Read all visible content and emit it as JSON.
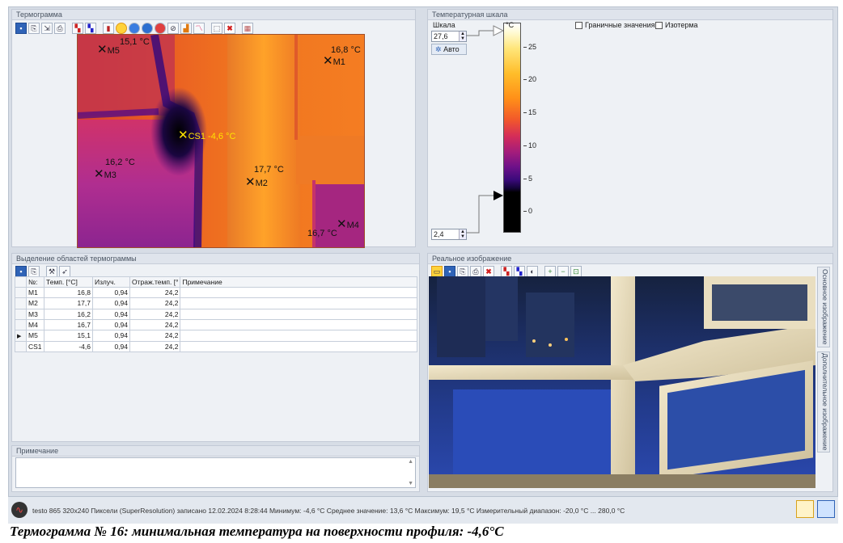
{
  "thermogram": {
    "title": "Термограмма",
    "markers": [
      {
        "label": "M5",
        "temp": "15,1 °C"
      },
      {
        "label": "M1",
        "temp": "16,8 °C"
      },
      {
        "label": "CS1",
        "temp": "-4,6 °C",
        "text": "CS1 -4,6 °C"
      },
      {
        "label": "M3",
        "temp": "16,2 °C"
      },
      {
        "label": "M2",
        "temp": "17,7 °C"
      },
      {
        "label": "M4",
        "temp": "16,7 °C"
      }
    ]
  },
  "scale": {
    "title": "Температурная шкала",
    "scale_label": "Шкала",
    "max_value": "27,6",
    "min_value": "2,4",
    "auto_label": "Авто",
    "unit": "°C",
    "ticks": [
      "25",
      "20",
      "15",
      "10",
      "5",
      "0"
    ],
    "boundary_label": "Граничные значения",
    "isotherm_label": "Изотерма"
  },
  "regions": {
    "title": "Выделение областей термограммы",
    "columns": [
      "№:",
      "Темп. [°C]",
      "Излуч.",
      "Отраж.темп. [°",
      "Примечание"
    ],
    "rows": [
      [
        "M1",
        "16,8",
        "0,94",
        "24,2",
        ""
      ],
      [
        "M2",
        "17,7",
        "0,94",
        "24,2",
        ""
      ],
      [
        "M3",
        "16,2",
        "0,94",
        "24,2",
        ""
      ],
      [
        "M4",
        "16,7",
        "0,94",
        "24,2",
        ""
      ],
      [
        "M5",
        "15,1",
        "0,94",
        "24,2",
        ""
      ],
      [
        "CS1",
        "-4,6",
        "0,94",
        "24,2",
        ""
      ]
    ],
    "selected_row": 4
  },
  "note": {
    "title": "Примечание"
  },
  "real_image": {
    "title": "Реальное изображение",
    "tab_main": "Основное изображение",
    "tab_extra": "Дополнительное изображение"
  },
  "status": {
    "text": "testo 865 320x240 Пиксели (SuperResolution) записано 12.02.2024 8:28:44  Минимум: -4,6 °C  Среднее значение: 13,6 °C  Максимум: 19,5 °C  Измерительный диапазон: -20,0 °C ... 280,0 °C"
  },
  "caption": "Термограмма № 16: минимальная температура на поверхности профиля: -4,6°С",
  "colors": {
    "accent": "#2f63b7",
    "cold": "#000000",
    "warm": "#ff9018",
    "marker_highlight": "#ffe400"
  }
}
